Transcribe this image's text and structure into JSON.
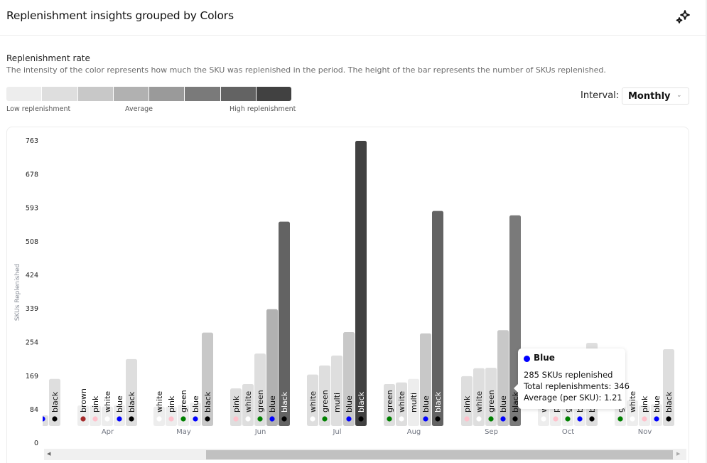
{
  "header": {
    "title": "Replenishment insights grouped by Colors",
    "action_icon": "sparkle-icon"
  },
  "legend": {
    "title": "Replenishment rate",
    "description": "The intensity of the color represents how much the SKU was replenished in the period. The height of the bar represents the number of SKUs replenished.",
    "scale_colors": [
      "#ededed",
      "#dedede",
      "#c8c8c8",
      "#b1b1b1",
      "#9a9a9a",
      "#7a7a7a",
      "#636363",
      "#414141"
    ],
    "low_label": "Low replenishment",
    "mid_label": "Average",
    "high_label": "High replenishment"
  },
  "interval": {
    "label": "Interval:",
    "value": "Monthly",
    "chevron": "chevron-down-icon"
  },
  "tooltip": {
    "title": "Blue",
    "dot_color": "#0000ff",
    "line1": "285 SKUs replenished",
    "line2": "Total replenishments: 346",
    "line3": "Average (per SKU): 1.21"
  },
  "scrollbar": {
    "left_arrow": "◀",
    "right_arrow": "▶"
  },
  "swatches": {
    "brown": "#a52a2a",
    "pink": "#ffc0cb",
    "white": "#ffffff",
    "blue": "#0000ff",
    "black": "#000000",
    "green": "#008000",
    "multi": null
  },
  "chart_data": {
    "type": "bar",
    "title": "Replenishment insights grouped by Colors",
    "xlabel": "",
    "ylabel": "SKUs Replenished",
    "ylim": [
      0,
      763
    ],
    "yticks": [
      0,
      84,
      169,
      254,
      339,
      424,
      508,
      593,
      678,
      763
    ],
    "grid": false,
    "groups": [
      {
        "month": "",
        "bars": [
          {
            "color": "blue",
            "value": 70,
            "shade": 1,
            "label_visible": false
          },
          {
            "color": "black",
            "value": 162,
            "shade": 1
          }
        ]
      },
      {
        "month": "Apr",
        "bars": [
          {
            "color": "brown",
            "value": 95,
            "shade": 0
          },
          {
            "color": "pink",
            "value": 95,
            "shade": 0
          },
          {
            "color": "white",
            "value": 92,
            "shade": 0
          },
          {
            "color": "blue",
            "value": 96,
            "shade": 0
          },
          {
            "color": "black",
            "value": 212,
            "shade": 1
          }
        ]
      },
      {
        "month": "May",
        "bars": [
          {
            "color": "white",
            "value": 92,
            "shade": 0
          },
          {
            "color": "pink",
            "value": 92,
            "shade": 0
          },
          {
            "color": "green",
            "value": 96,
            "shade": 0
          },
          {
            "color": "blue",
            "value": 102,
            "shade": 0
          },
          {
            "color": "black",
            "value": 279,
            "shade": 2
          }
        ]
      },
      {
        "month": "Jun",
        "bars": [
          {
            "color": "pink",
            "value": 138,
            "shade": 1
          },
          {
            "color": "white",
            "value": 149,
            "shade": 1
          },
          {
            "color": "green",
            "value": 226,
            "shade": 1
          },
          {
            "color": "blue",
            "value": 338,
            "shade": 3
          },
          {
            "color": "black",
            "value": 559,
            "shade": 6
          }
        ]
      },
      {
        "month": "Jul",
        "bars": [
          {
            "color": "white",
            "value": 173,
            "shade": 1
          },
          {
            "color": "green",
            "value": 196,
            "shade": 1
          },
          {
            "color": "multi",
            "value": 221,
            "shade": 1
          },
          {
            "color": "blue",
            "value": 280,
            "shade": 2
          },
          {
            "color": "black",
            "value": 763,
            "shade": 7
          }
        ]
      },
      {
        "month": "Aug",
        "bars": [
          {
            "color": "green",
            "value": 149,
            "shade": 1
          },
          {
            "color": "white",
            "value": 153,
            "shade": 1
          },
          {
            "color": "multi",
            "value": 162,
            "shade": 0
          },
          {
            "color": "blue",
            "value": 277,
            "shade": 2
          },
          {
            "color": "black",
            "value": 586,
            "shade": 6
          }
        ]
      },
      {
        "month": "Sep",
        "bars": [
          {
            "color": "pink",
            "value": 169,
            "shade": 1
          },
          {
            "color": "white",
            "value": 189,
            "shade": 1
          },
          {
            "color": "green",
            "value": 190,
            "shade": 1
          },
          {
            "color": "blue",
            "value": 285,
            "shade": 2
          },
          {
            "color": "black",
            "value": 575,
            "shade": 5
          }
        ]
      },
      {
        "month": "Oct",
        "bars": [
          {
            "color": "white",
            "value": 92,
            "shade": 0
          },
          {
            "color": "pink",
            "value": 92,
            "shade": 0
          },
          {
            "color": "green",
            "value": 92,
            "shade": 0
          },
          {
            "color": "blue",
            "value": 92,
            "shade": 0
          },
          {
            "color": "black",
            "value": 253,
            "shade": 1
          }
        ]
      },
      {
        "month": "Nov",
        "bars": [
          {
            "color": "green",
            "value": 92,
            "shade": 0
          },
          {
            "color": "white",
            "value": 108,
            "shade": 0
          },
          {
            "color": "pink",
            "value": 95,
            "shade": 0
          },
          {
            "color": "blue",
            "value": 98,
            "shade": 0
          },
          {
            "color": "black",
            "value": 237,
            "shade": 1
          }
        ]
      }
    ],
    "legend": "top-left",
    "highlighted_bar": {
      "month": "Sep",
      "color": "blue",
      "value": 285
    }
  }
}
